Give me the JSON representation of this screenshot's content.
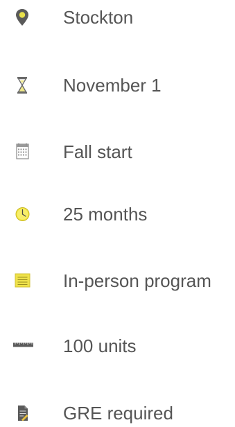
{
  "facts": [
    {
      "icon": "location-pin-icon",
      "label": "Stockton"
    },
    {
      "icon": "hourglass-icon",
      "label": "November 1"
    },
    {
      "icon": "calendar-icon",
      "label": "Fall start"
    },
    {
      "icon": "clock-icon",
      "label": "25 months"
    },
    {
      "icon": "notepad-icon",
      "label": "In-person program"
    },
    {
      "icon": "ruler-icon",
      "label": "100 units"
    },
    {
      "icon": "document-edit-icon",
      "label": "GRE required"
    }
  ],
  "colors": {
    "text": "#555555",
    "icon_dark": "#5a5a5a",
    "icon_yellow": "#e8e04a",
    "icon_gray": "#9a9a9a"
  }
}
